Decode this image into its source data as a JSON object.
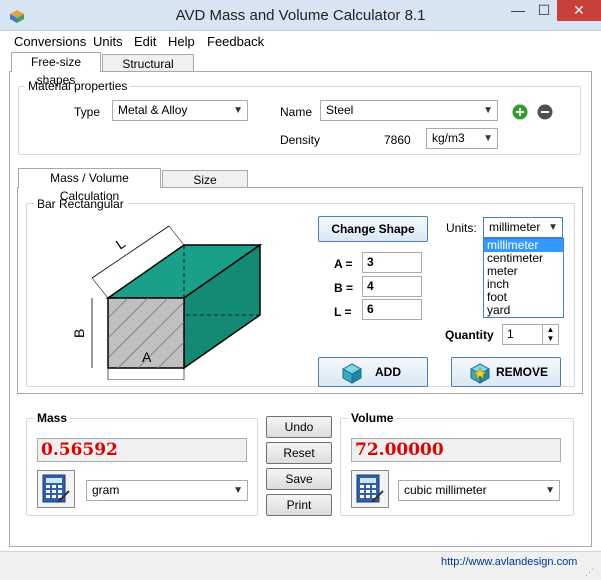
{
  "window": {
    "title": "AVD Mass and Volume Calculator 8.1",
    "minimize": "—",
    "maximize": "☐",
    "close": "✕"
  },
  "menu": [
    "Conversions",
    "Units",
    "Edit",
    "Help",
    "Feedback"
  ],
  "main_tabs": [
    "Free-size shapes",
    "Structural shapes"
  ],
  "material": {
    "group_label": "Material properties",
    "type_label": "Type",
    "type_value": "Metal & Alloy",
    "name_label": "Name",
    "name_value": "Steel",
    "density_label": "Density",
    "density_value": "7860",
    "density_unit": "kg/m3"
  },
  "calc_tabs": [
    "Mass / Volume  Calculation",
    "Size  Calculation"
  ],
  "shape": {
    "group_label": "Bar Rectangular",
    "dim_labels": {
      "length": "L",
      "height": "B",
      "width": "A"
    },
    "change_shape": "Change Shape",
    "units_label": "Units:",
    "units_value": "millimeter",
    "units_options": [
      "millimeter",
      "centimeter",
      "meter",
      "inch",
      "foot",
      "yard"
    ],
    "params": [
      {
        "label": "A =",
        "value": "3"
      },
      {
        "label": "B =",
        "value": "4"
      },
      {
        "label": "L =",
        "value": "6"
      }
    ],
    "quantity_label": "Quantity",
    "quantity_value": "1",
    "add": "ADD",
    "remove": "REMOVE"
  },
  "mass": {
    "label": "Mass",
    "value": "0.56592",
    "unit": "gram"
  },
  "volume": {
    "label": "Volume",
    "value": "72.00000",
    "unit": "cubic millimeter"
  },
  "actions": [
    "Undo",
    "Reset",
    "Save",
    "Print"
  ],
  "status": {
    "url": "http://www.avlandesign.com"
  },
  "colors": {
    "bar_front": "#1aa088",
    "bar_cross_section": "#c0c0c0",
    "readout_text": "#e00000"
  }
}
